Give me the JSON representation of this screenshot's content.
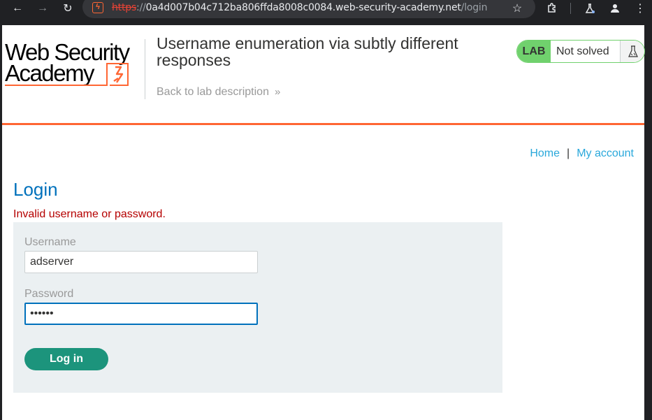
{
  "browser": {
    "url": {
      "scheme": "https",
      "separator": "://",
      "host": "0a4d007b04c712ba806ffda8008c0084.web-security-academy.net",
      "path": "/login"
    },
    "icons": [
      "back-arrow-icon",
      "forward-arrow-icon",
      "reload-icon",
      "site-info-icon",
      "bookmark-star-icon",
      "extensions-icon",
      "labs-flask-icon",
      "profile-icon",
      "menu-icon"
    ]
  },
  "header": {
    "logo": {
      "line1": "Web Security",
      "line2": "Academy"
    },
    "lab_title": "Username enumeration via subtly different responses",
    "back_link": "Back to lab description",
    "status": {
      "badge": "LAB",
      "state": "Not solved"
    }
  },
  "nav": {
    "home": "Home",
    "separator": "|",
    "my_account": "My account"
  },
  "login": {
    "heading": "Login",
    "error": "Invalid username or password.",
    "username_label": "Username",
    "username_value": "adserver",
    "password_label": "Password",
    "password_value": "••••••",
    "submit_label": "Log in"
  },
  "colors": {
    "brand_orange": "#ff6633",
    "heading_blue": "#0071bc",
    "link_blue": "#29a8db",
    "error_red": "#b50000",
    "button_green": "#1c947c",
    "lab_green": "#70d16d",
    "panel_bg": "#ebf0f2"
  }
}
